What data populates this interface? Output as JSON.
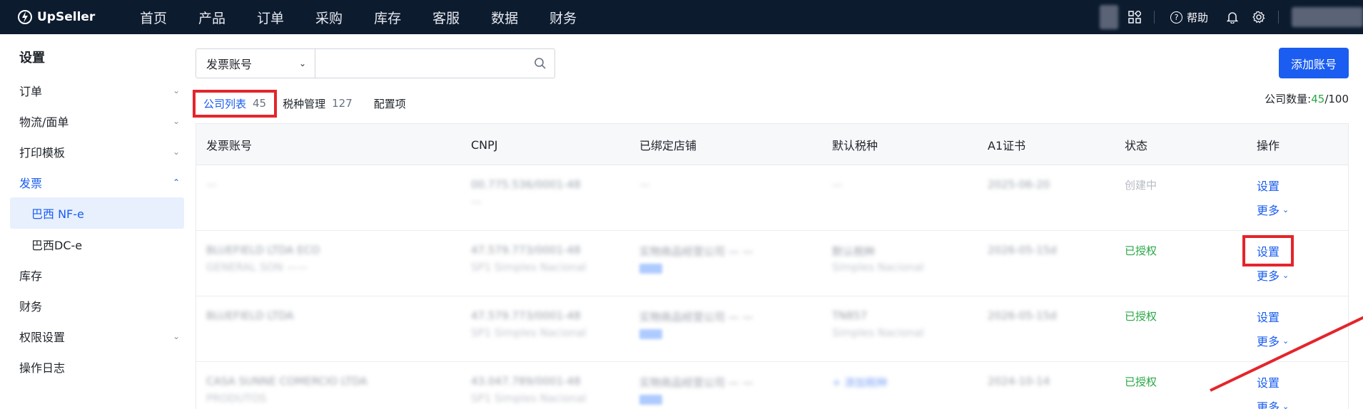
{
  "app": {
    "name": "UpSeller"
  },
  "nav": [
    "首页",
    "产品",
    "订单",
    "采购",
    "库存",
    "客服",
    "数据",
    "财务"
  ],
  "topbar": {
    "help_label": "帮助"
  },
  "sidebar": {
    "title": "设置",
    "items": [
      {
        "label": "订单",
        "expandable": true
      },
      {
        "label": "物流/面单",
        "expandable": true
      },
      {
        "label": "打印模板",
        "expandable": true
      },
      {
        "label": "发票",
        "expandable": true,
        "expanded": true
      },
      {
        "label": "库存",
        "expandable": false
      },
      {
        "label": "财务",
        "expandable": false
      },
      {
        "label": "权限设置",
        "expandable": true
      },
      {
        "label": "操作日志",
        "expandable": false
      }
    ],
    "sub_items": [
      "巴西 NF-e",
      "巴西DC-e"
    ]
  },
  "search": {
    "select_value": "发票账号",
    "placeholder": ""
  },
  "add_button": "添加账号",
  "tabs": [
    {
      "label": "公司列表",
      "count": "45",
      "active": true
    },
    {
      "label": "税种管理",
      "count": "127",
      "active": false
    },
    {
      "label": "配置项",
      "count": "",
      "active": false
    }
  ],
  "company_count": {
    "label": "公司数量:",
    "current": "45",
    "total": "/100"
  },
  "table": {
    "columns": [
      "发票账号",
      "CNPJ",
      "已绑定店铺",
      "默认税种",
      "A1证书",
      "状态",
      "操作"
    ],
    "rows": [
      {
        "status": "创建中",
        "status_type": "creating",
        "op_set": "设置",
        "op_more": "更多"
      },
      {
        "status": "已授权",
        "status_type": "auth",
        "op_set": "设置",
        "op_more": "更多"
      },
      {
        "status": "已授权",
        "status_type": "auth",
        "op_set": "设置",
        "op_more": "更多"
      },
      {
        "status": "已授权",
        "status_type": "auth",
        "op_set": "设置",
        "op_more": "更多"
      }
    ]
  },
  "colors": {
    "accent": "#1a5df0",
    "topbar": "#0d1b2f",
    "success": "#28a745",
    "annotation": "#e4252b"
  }
}
